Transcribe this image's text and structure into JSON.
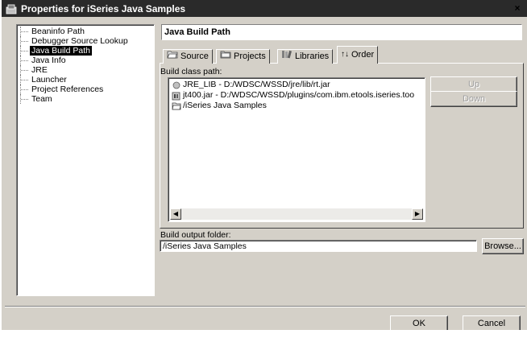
{
  "window": {
    "title": "Properties for iSeries Java Samples",
    "close_glyph": "×"
  },
  "tree": {
    "items": [
      {
        "label": "Beaninfo Path",
        "selected": false
      },
      {
        "label": "Debugger Source Lookup",
        "selected": false
      },
      {
        "label": "Java Build Path",
        "selected": true
      },
      {
        "label": "Java Info",
        "selected": false
      },
      {
        "label": "JRE",
        "selected": false
      },
      {
        "label": "Launcher",
        "selected": false
      },
      {
        "label": "Project References",
        "selected": false
      },
      {
        "label": "Team",
        "selected": false
      }
    ]
  },
  "page": {
    "title": "Java Build Path"
  },
  "tabs": [
    {
      "label": "Source",
      "icon": "source-folder-icon"
    },
    {
      "label": "Projects",
      "icon": "projects-folder-icon"
    },
    {
      "label": "Libraries",
      "icon": "libraries-icon"
    },
    {
      "label": "Order",
      "icon": "order-arrows-icon",
      "active": true,
      "glyph": "↑↓"
    }
  ],
  "order": {
    "build_class_path_label": "Build class path:",
    "entries": [
      {
        "label": "JRE_LIB - D:/WDSC/WSSD/jre/lib/rt.jar",
        "icon": "variable-icon"
      },
      {
        "label": "jt400.jar - D:/WDSC/WSSD/plugins/com.ibm.etools.iseries.too",
        "icon": "jar-icon"
      },
      {
        "label": "/iSeries Java Samples",
        "icon": "project-folder-icon"
      }
    ],
    "up_label": "Up",
    "down_label": "Down"
  },
  "output": {
    "label": "Build output folder:",
    "value": "/iSeries Java Samples",
    "browse_label": "Browse..."
  },
  "buttons": {
    "ok_label": "OK",
    "cancel_label": "Cancel"
  },
  "colors": {
    "face": "#d4d0c8",
    "title_bar": "#2a2a2a",
    "selection": "#000000"
  }
}
